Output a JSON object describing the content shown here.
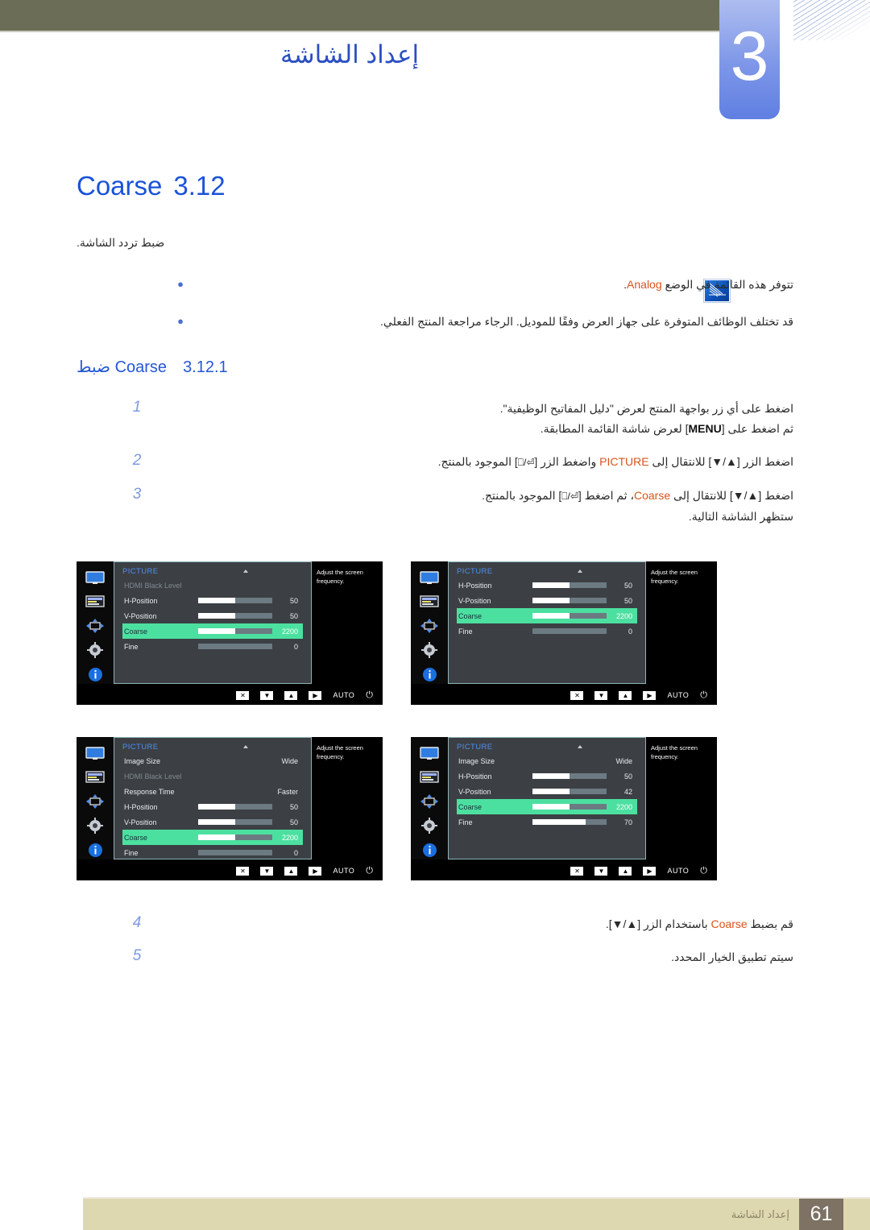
{
  "header": {
    "chapter_number": "3",
    "chapter_title": "إعداد الشاشة"
  },
  "section": {
    "number": "3.12",
    "title": "Coarse",
    "lead": "ضبط تردد الشاشة."
  },
  "notes": {
    "icon": "note-icon",
    "items": [
      {
        "text_before": "تتوفر هذه القائمة في الوضع ",
        "highlight": "Analog",
        "text_after": "."
      },
      {
        "text_before": "قد تختلف الوظائف المتوفرة على جهاز العرض وفقًا للموديل. الرجاء مراجعة المنتج الفعلي.",
        "highlight": "",
        "text_after": ""
      }
    ]
  },
  "subsection": {
    "number": "3.12.1",
    "title_ar": "ضبط",
    "title_en": "Coarse"
  },
  "steps": [
    {
      "n": "1",
      "line1_a": "اضغط على أي زر بواجهة المنتج لعرض \"دليل المفاتيح الوظيفية\".",
      "line2_a": "ثم اضغط على [",
      "key": "MENU",
      "line2_b": "] لعرض شاشة القائمة المطابقة."
    },
    {
      "n": "2",
      "a": "اضغط الزر [▲/▼] للانتقال إلى ",
      "kw": "PICTURE",
      "b": " واضغط الزر [",
      "c": "] الموجود بالمنتج."
    },
    {
      "n": "3",
      "a": "اضغط [▲/▼] للانتقال إلى ",
      "kw": "Coarse",
      "b": "، ثم اضغط [",
      "c": "] الموجود بالمنتج.",
      "after": "ستظهر الشاشة التالية."
    },
    {
      "n": "4",
      "a": "قم بضبط ",
      "kw": "Coarse",
      "b": " باستخدام الزر [▲/▼]."
    },
    {
      "n": "5",
      "a": "سيتم تطبيق الخيار المحدد."
    }
  ],
  "osd_common": {
    "title": "PICTURE",
    "help_text": "Adjust the screen frequency.",
    "buttons": [
      "✕",
      "▼",
      "▲",
      "▶"
    ],
    "auto_label": "AUTO",
    "power_label": "⏻",
    "side_icons": [
      "monitor-icon",
      "picture-icon",
      "move-icon",
      "gear-icon",
      "info-icon"
    ],
    "highlight_color": "#4ce0a0"
  },
  "osd_figures": [
    {
      "name": "osd-figure-1",
      "rows": [
        {
          "label": "HDMI Black Level",
          "type": "dim",
          "value": "",
          "bar": null
        },
        {
          "label": "H-Position",
          "type": "bar",
          "value": "50",
          "bar": 50
        },
        {
          "label": "V-Position",
          "type": "bar",
          "value": "50",
          "bar": 50
        },
        {
          "label": "Coarse",
          "type": "bar",
          "value": "2200",
          "bar": 50,
          "selected": true
        },
        {
          "label": "Fine",
          "type": "bar",
          "value": "0",
          "bar": 0
        }
      ]
    },
    {
      "name": "osd-figure-2",
      "rows": [
        {
          "label": "H-Position",
          "type": "bar",
          "value": "50",
          "bar": 50
        },
        {
          "label": "V-Position",
          "type": "bar",
          "value": "50",
          "bar": 50
        },
        {
          "label": "Coarse",
          "type": "bar",
          "value": "2200",
          "bar": 50,
          "selected": true
        },
        {
          "label": "Fine",
          "type": "bar",
          "value": "0",
          "bar": 0
        }
      ]
    },
    {
      "name": "osd-figure-3",
      "rows": [
        {
          "label": "Image Size",
          "type": "text",
          "value": "Wide",
          "bar": null
        },
        {
          "label": "HDMI Black Level",
          "type": "dim",
          "value": "",
          "bar": null
        },
        {
          "label": "Response Time",
          "type": "text",
          "value": "Faster",
          "bar": null
        },
        {
          "label": "H-Position",
          "type": "bar",
          "value": "50",
          "bar": 50
        },
        {
          "label": "V-Position",
          "type": "bar",
          "value": "50",
          "bar": 50
        },
        {
          "label": "Coarse",
          "type": "bar",
          "value": "2200",
          "bar": 50,
          "selected": true
        },
        {
          "label": "Fine",
          "type": "bar",
          "value": "0",
          "bar": 0
        }
      ]
    },
    {
      "name": "osd-figure-4",
      "rows": [
        {
          "label": "Image Size",
          "type": "text",
          "value": "Wide",
          "bar": null
        },
        {
          "label": "H-Position",
          "type": "bar",
          "value": "50",
          "bar": 50
        },
        {
          "label": "V-Position",
          "type": "bar",
          "value": "42",
          "bar": 50
        },
        {
          "label": "Coarse",
          "type": "bar",
          "value": "2200",
          "bar": 50,
          "selected": true
        },
        {
          "label": "Fine",
          "type": "bar",
          "value": "70",
          "bar": 72
        }
      ]
    }
  ],
  "footer": {
    "page_number": "61",
    "chapter_label": "إعداد الشاشة"
  }
}
